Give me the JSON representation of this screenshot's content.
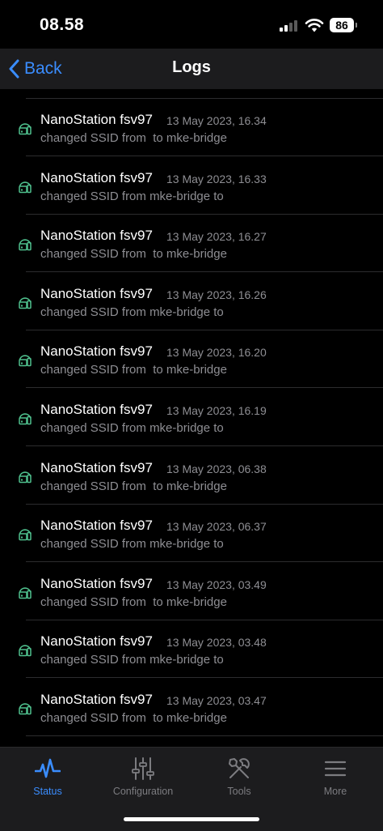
{
  "status_bar": {
    "time": "08.58",
    "battery": "86"
  },
  "nav": {
    "back_label": "Back",
    "title": "Logs"
  },
  "logs": [
    {
      "device": "NanoStation fsv97",
      "date": "13 May 2023, 16.34",
      "message": "changed SSID from  to mke-bridge"
    },
    {
      "device": "NanoStation fsv97",
      "date": "13 May 2023, 16.33",
      "message": "changed SSID from mke-bridge to"
    },
    {
      "device": "NanoStation fsv97",
      "date": "13 May 2023, 16.27",
      "message": "changed SSID from  to mke-bridge"
    },
    {
      "device": "NanoStation fsv97",
      "date": "13 May 2023, 16.26",
      "message": "changed SSID from mke-bridge to"
    },
    {
      "device": "NanoStation fsv97",
      "date": "13 May 2023, 16.20",
      "message": "changed SSID from  to mke-bridge"
    },
    {
      "device": "NanoStation fsv97",
      "date": "13 May 2023, 16.19",
      "message": "changed SSID from mke-bridge to"
    },
    {
      "device": "NanoStation fsv97",
      "date": "13 May 2023, 06.38",
      "message": "changed SSID from  to mke-bridge"
    },
    {
      "device": "NanoStation fsv97",
      "date": "13 May 2023, 06.37",
      "message": "changed SSID from mke-bridge to"
    },
    {
      "device": "NanoStation fsv97",
      "date": "13 May 2023, 03.49",
      "message": "changed SSID from  to mke-bridge"
    },
    {
      "device": "NanoStation fsv97",
      "date": "13 May 2023, 03.48",
      "message": "changed SSID from mke-bridge to"
    },
    {
      "device": "NanoStation fsv97",
      "date": "13 May 2023, 03.47",
      "message": "changed SSID from  to mke-bridge"
    }
  ],
  "tabs": [
    {
      "label": "Status",
      "icon": "pulse-icon",
      "active": true
    },
    {
      "label": "Configuration",
      "icon": "sliders-icon",
      "active": false
    },
    {
      "label": "Tools",
      "icon": "tools-icon",
      "active": false
    },
    {
      "label": "More",
      "icon": "menu-icon",
      "active": false
    }
  ],
  "colors": {
    "accent": "#3a8dff",
    "device_icon": "#4fc08d",
    "secondary_text": "#8e8e93",
    "background": "#000000",
    "bar_background": "#1c1c1e"
  }
}
